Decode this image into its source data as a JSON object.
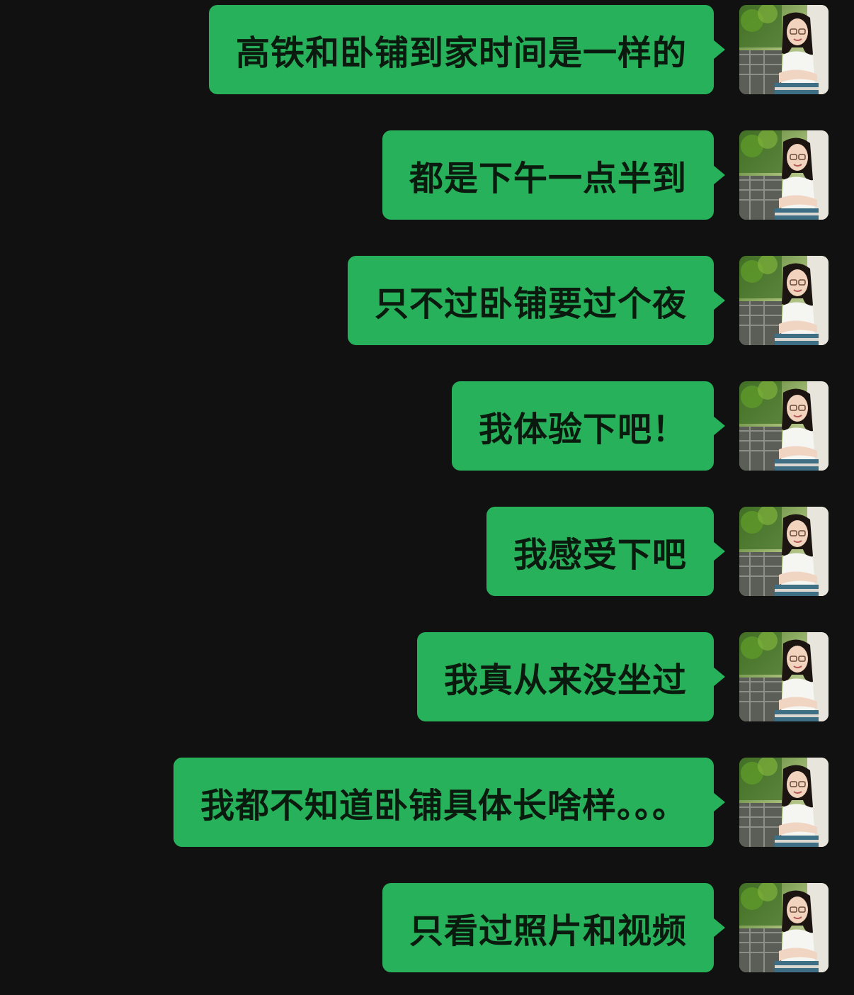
{
  "messages": [
    {
      "text": "高铁和卧铺到家时间是一样的"
    },
    {
      "text": "都是下午一点半到"
    },
    {
      "text": "只不过卧铺要过个夜"
    },
    {
      "text": "我体验下吧！"
    },
    {
      "text": "我感受下吧"
    },
    {
      "text": "我真从来没坐过"
    },
    {
      "text": "我都不知道卧铺具体长啥样。。。"
    },
    {
      "text": "只看过照片和视频"
    }
  ],
  "colors": {
    "background": "#111111",
    "bubble": "#27b15a",
    "bubble_text": "#0b1a0e"
  },
  "avatar_icon": "user-avatar-photo"
}
